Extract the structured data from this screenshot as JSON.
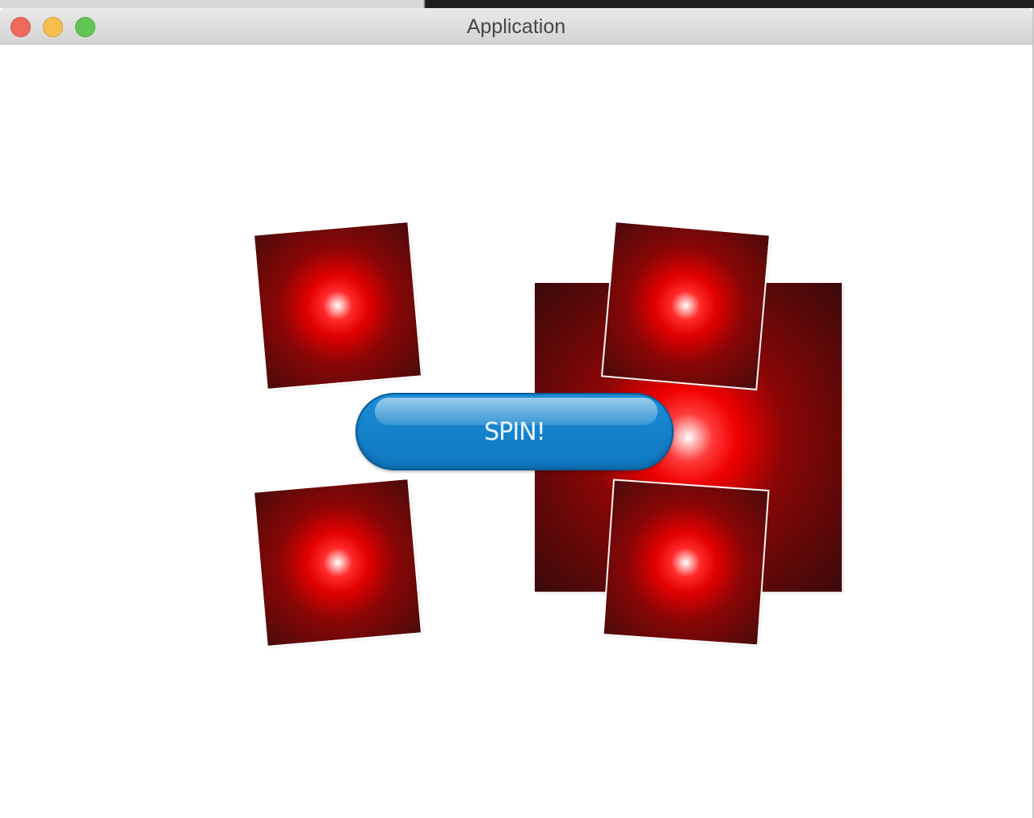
{
  "window": {
    "title": "Application"
  },
  "controls": {
    "close": "close",
    "minimize": "minimize",
    "maximize": "maximize"
  },
  "game": {
    "spin_label": "SPIN!"
  },
  "colors": {
    "tile_dark": "#4a0b0b",
    "tile_glow": "#ff2a2a",
    "button_blue": "#1683cc"
  }
}
